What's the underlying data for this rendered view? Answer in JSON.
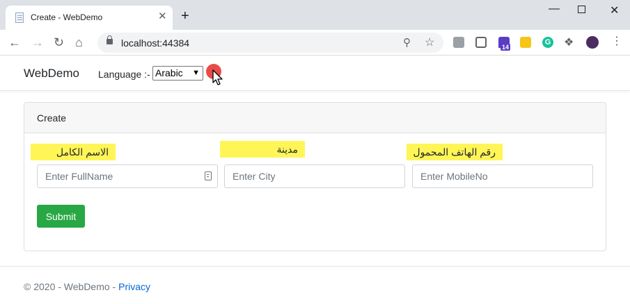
{
  "browser": {
    "tab_title": "Create - WebDemo",
    "tab_close": "✕",
    "new_tab": "+",
    "window_min": "—",
    "window_close": "✕",
    "url": "localhost:44384",
    "extension_badge": "14",
    "grammarly_letter": "G"
  },
  "navbar": {
    "brand": "WebDemo",
    "language_label": "Language :-",
    "language_selected": "Arabic"
  },
  "card": {
    "title": "Create"
  },
  "form": {
    "fullname_label": "الاسم الكامل",
    "fullname_placeholder": "Enter FullName",
    "city_label": "مدينة",
    "city_placeholder": "Enter City",
    "mobile_label": "رقم الهاتف المحمول",
    "mobile_placeholder": "Enter MobileNo",
    "submit_label": "Submit"
  },
  "footer": {
    "copyright": "© 2020 - WebDemo -",
    "privacy_link": "Privacy"
  },
  "colors": {
    "highlight": "#fff557",
    "submit": "#28a745",
    "link": "#0366d6"
  }
}
